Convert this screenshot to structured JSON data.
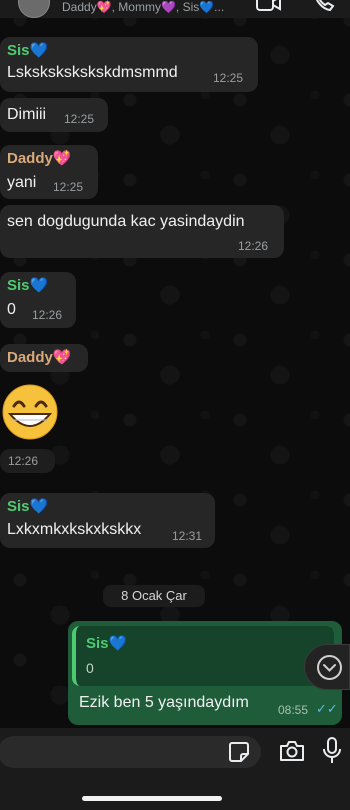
{
  "header": {
    "subtitle": "Daddy💖, Mommy💜, Sis💙..."
  },
  "messages": [
    {
      "sender": "Sis",
      "sender_heart": "💙",
      "text": "Lskskskskskskdmsmmd",
      "time": "12:25"
    },
    {
      "text": "Dimiii",
      "time": "12:25"
    },
    {
      "sender": "Daddy",
      "sender_heart": "💖",
      "text": "yani",
      "time": "12:25"
    },
    {
      "text": "sen dogdugunda kac yasindaydin",
      "time": "12:26"
    },
    {
      "sender": "Sis",
      "sender_heart": "💙",
      "text": "0",
      "time": "12:26"
    },
    {
      "sender": "Daddy",
      "sender_heart": "💖"
    },
    {
      "emoji": "😁",
      "time": "12:26"
    },
    {
      "sender": "Sis",
      "sender_heart": "💙",
      "text": "Lxkxmkxkskxkskkx",
      "time": "12:31"
    }
  ],
  "date_separator": "8 Ocak Çar",
  "outgoing": {
    "quote_sender": "Sis",
    "quote_heart": "💙",
    "quote_text": "0",
    "text": "Ezik ben 5 yaşındaydım",
    "time": "08:55",
    "ticks": "✓✓"
  },
  "icons": {
    "video": "video-camera-icon",
    "call": "phone-icon",
    "sticker": "sticker-icon",
    "camera": "camera-icon",
    "mic": "microphone-icon",
    "scroll": "chevron-down-icon"
  },
  "colors": {
    "sender_sis": "#4ecb71",
    "sender_daddy": "#d9a97a",
    "incoming_bubble": "#262626",
    "outgoing_bubble": "#1f5c3a",
    "read_ticks": "#53bdeb"
  },
  "composer": {
    "value": ""
  }
}
